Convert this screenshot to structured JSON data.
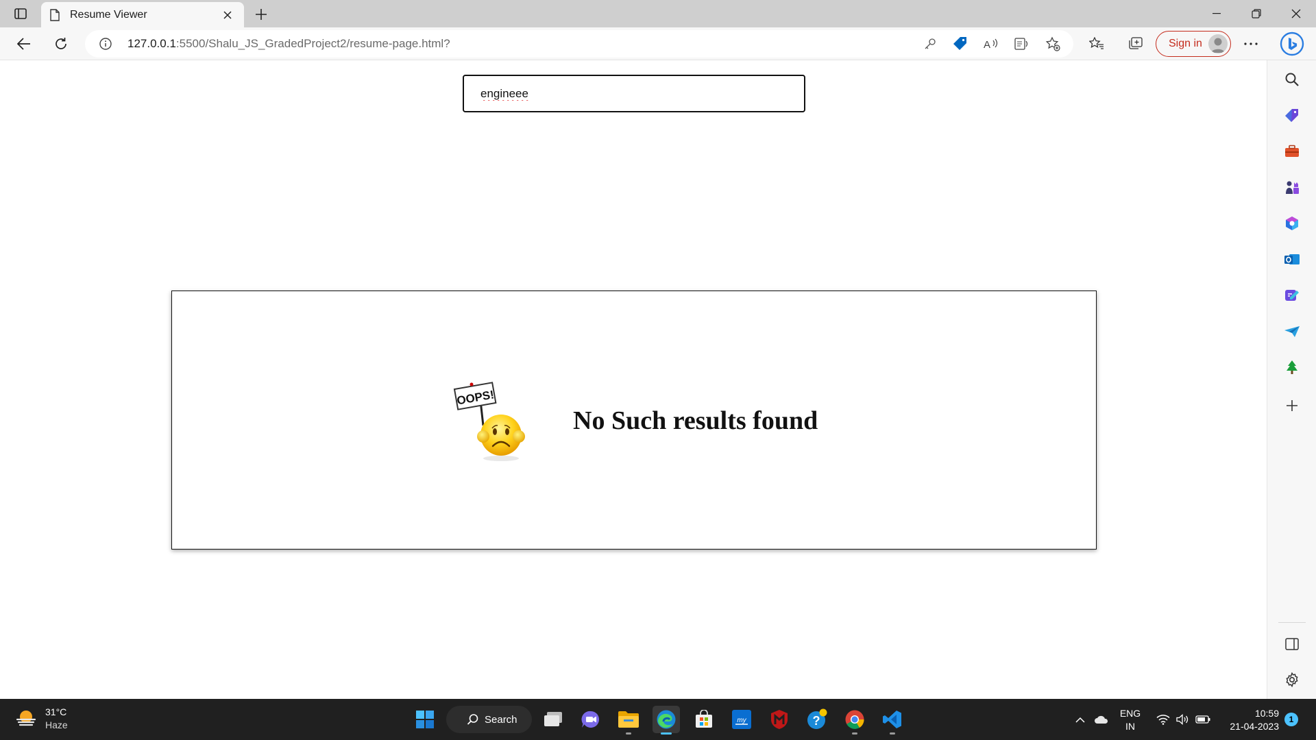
{
  "browser": {
    "tab": {
      "title": "Resume Viewer"
    },
    "url": {
      "host": "127.0.0.1",
      "path": ":5500/Shalu_JS_GradedProject2/resume-page.html?"
    },
    "signin_label": "Sign in"
  },
  "page": {
    "search": {
      "value": "engineee"
    },
    "result": {
      "oops_label": "OOPS!",
      "message": "No Such results found"
    }
  },
  "taskbar": {
    "weather": {
      "temp": "31°C",
      "condition": "Haze"
    },
    "search_label": "Search",
    "lang": {
      "line1": "ENG",
      "line2": "IN"
    },
    "clock": {
      "time": "10:59",
      "date": "21-04-2023"
    },
    "notifications": "1"
  },
  "colors": {
    "accent": "#0067c0",
    "signin": "#c42b1c",
    "taskbar": "#202020"
  }
}
